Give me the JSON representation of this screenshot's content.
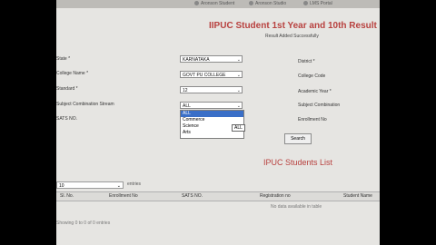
{
  "browser": {
    "tabs": [
      "Aronson Student",
      "Aronson Studio",
      "LMS Portal"
    ]
  },
  "page": {
    "title": "IIPUC Student 1st Year and 10th Result Entry",
    "subtitle": "Result Added Successfully"
  },
  "form": {
    "state_label": "State *",
    "state_value": "KARNATAKA",
    "district_label": "District *",
    "college_label": "College Name *",
    "college_value": "GOVT PU COLLEGE",
    "college_code_label": "College Code",
    "standard_label": "Standard *",
    "standard_value": "12",
    "academic_year_label": "Academic Year *",
    "combination_label": "Subject Combination Stream",
    "combination_value": "ALL",
    "combination_right_label": "Subject Combination",
    "sats_label": "SATS NO.",
    "enrollment_label": "Enrollment No",
    "dropdown_options": [
      "ALL",
      "Commerce",
      "Science",
      "Arts"
    ],
    "tooltip": "ALL",
    "search_button": "Search"
  },
  "list": {
    "title": "IPUC Students List",
    "entries_value": "10",
    "entries_label": "entries",
    "columns": [
      "Sl. No.",
      "Enrollment No",
      "SATS NO.",
      "Registration no",
      "Student Name"
    ],
    "empty_text": "No data available in table",
    "info_text": "Showing 0 to 0 of 0 entries"
  }
}
